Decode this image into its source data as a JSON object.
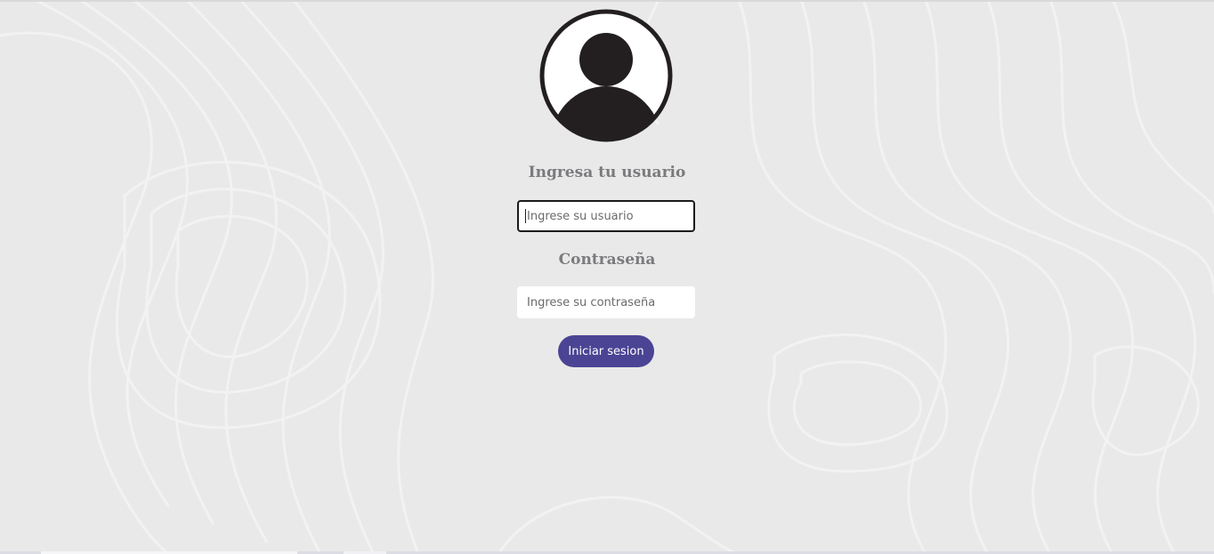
{
  "login": {
    "user_label": "Ingresa tu usuario",
    "user_placeholder": "Ingrese su usuario",
    "user_value": "",
    "password_label": "Contraseña",
    "password_placeholder": "Ingrese su contraseña",
    "password_value": "",
    "submit_label": "Iniciar sesion"
  },
  "icons": {
    "avatar": "user-avatar-icon"
  },
  "colors": {
    "background": "#e8e8e9",
    "label_text": "#7b7b7d",
    "button_bg": "#4b4494",
    "button_text": "#ffffff",
    "avatar_dark": "#231f20"
  }
}
